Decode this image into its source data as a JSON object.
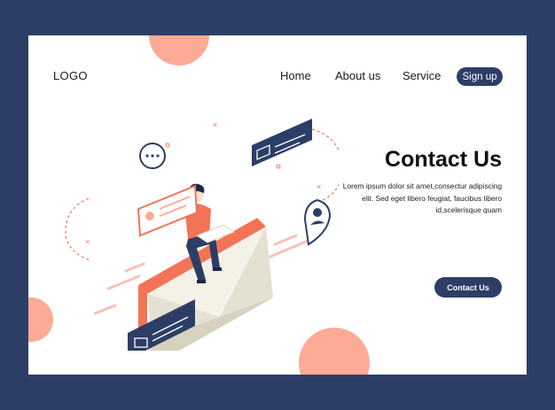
{
  "header": {
    "logo": "LOGO",
    "nav": {
      "home": "Home",
      "about": "About us",
      "service": "Service"
    },
    "signup_label": "Sign up"
  },
  "hero": {
    "title": "Contact Us",
    "description": "Lorem ipsum dolor sit amet,consectur adipiscing elit. Sed eget libero feugiat, faucibus libero id,scelerisque quam",
    "cta_label": "Contact Us"
  },
  "colors": {
    "frame": "#2d3e66",
    "accent": "#fdaa96",
    "orange": "#f37357",
    "envelope": "#e4e1d2"
  },
  "icons": [
    "chat-bubble-icon",
    "mail-card-icon",
    "profile-card-icon",
    "location-pin-icon",
    "envelope-icon"
  ]
}
